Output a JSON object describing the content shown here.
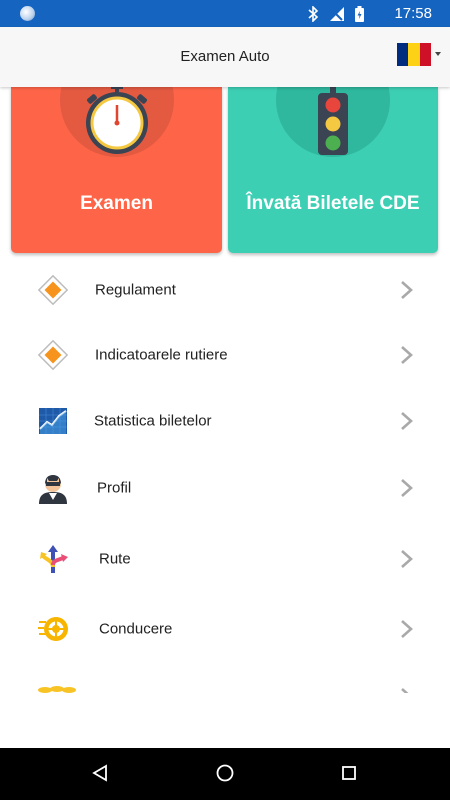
{
  "status_bar": {
    "time": "17:58"
  },
  "app_bar": {
    "title": "Examen Auto",
    "flag_colors": [
      "#002b7f",
      "#fcd116",
      "#ce1126"
    ]
  },
  "cards": [
    {
      "label": "Examen",
      "icon": "stopwatch-icon",
      "color": "#fe6548"
    },
    {
      "label": "Învată Biletele CDE",
      "icon": "traffic-light-icon",
      "color": "#3dcfb4"
    }
  ],
  "menu": {
    "items": [
      {
        "label": "Regulament",
        "icon": "diamond-sign-icon"
      },
      {
        "label": "Indicatoarele rutiere",
        "icon": "diamond-sign-icon"
      },
      {
        "label": "Statistica biletelor",
        "icon": "chart-icon"
      },
      {
        "label": "Profil",
        "icon": "avatar-icon"
      },
      {
        "label": "Rute",
        "icon": "route-arrows-icon"
      },
      {
        "label": "Conducere",
        "icon": "wheel-icon"
      }
    ]
  },
  "nav_bar": {
    "icons": [
      "back-icon",
      "home-icon",
      "recents-icon"
    ]
  }
}
